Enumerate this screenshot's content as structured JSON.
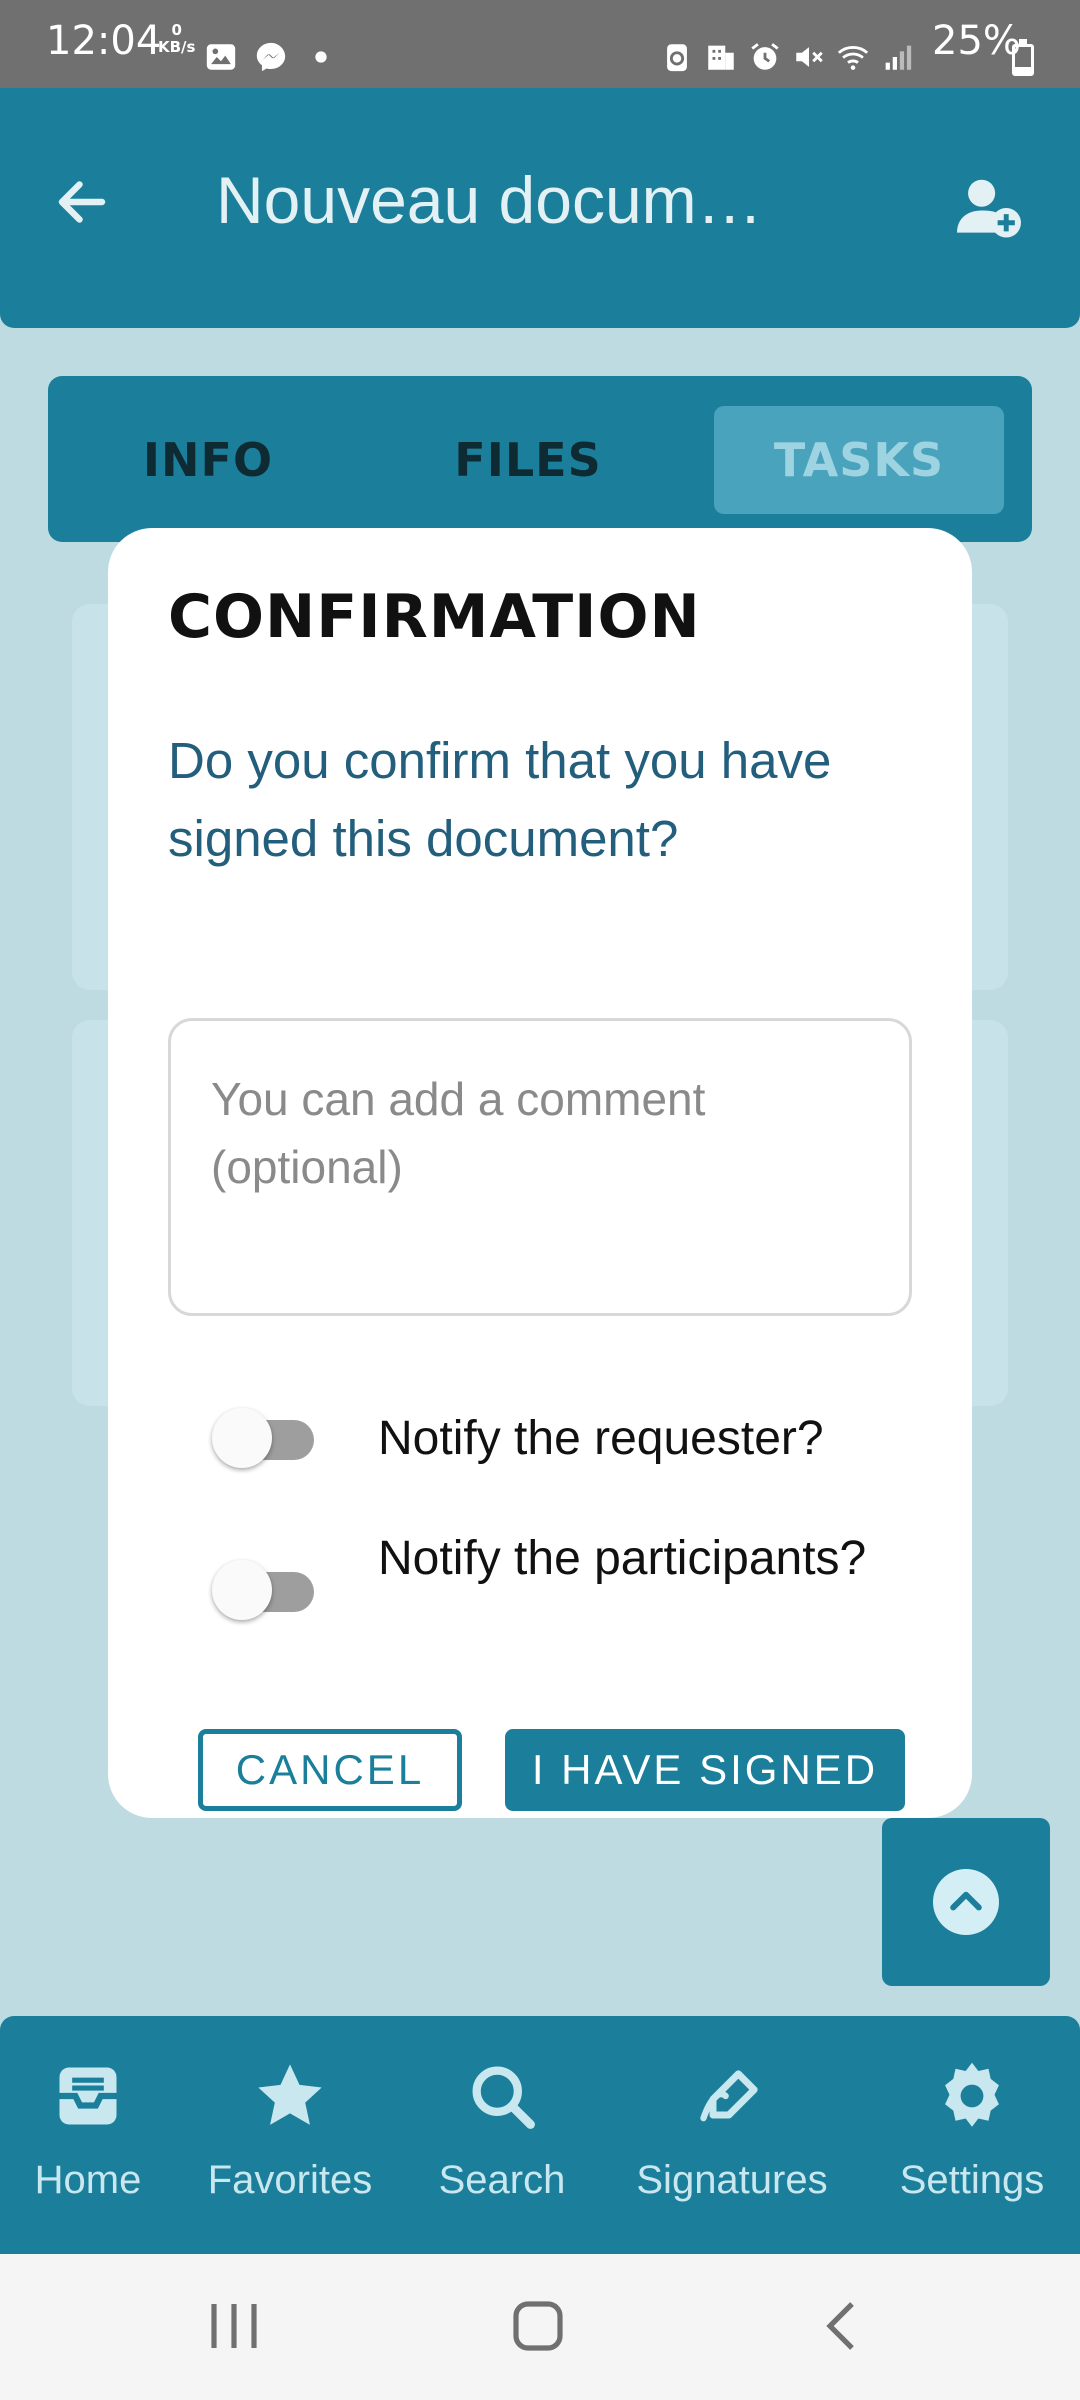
{
  "status_bar": {
    "time": "12:04",
    "data_rate_value": "0",
    "data_rate_unit": "KB/s",
    "battery_text": "25%",
    "battery_level": 0.25
  },
  "app_bar": {
    "title": "Nouveau docum…"
  },
  "tabs": [
    {
      "label": "INFO",
      "active": false
    },
    {
      "label": "FILES",
      "active": false
    },
    {
      "label": "TASKS",
      "active": true
    }
  ],
  "dialog": {
    "title": "CONFIRMATION",
    "question": "Do you confirm that you have signed this document?",
    "comment_placeholder": "You can add a comment (optional)",
    "comment_value": "",
    "toggles": [
      {
        "label": "Notify the requester?",
        "on": false
      },
      {
        "label": "Notify the participants?",
        "on": false
      }
    ],
    "cancel_label": "CANCEL",
    "confirm_label": "I HAVE SIGNED"
  },
  "bottom_nav": [
    {
      "label": "Home",
      "icon": "inbox-icon"
    },
    {
      "label": "Favorites",
      "icon": "star-icon"
    },
    {
      "label": "Search",
      "icon": "search-icon"
    },
    {
      "label": "Signatures",
      "icon": "signature-pen-icon"
    },
    {
      "label": "Settings",
      "icon": "gear-icon"
    }
  ],
  "colors": {
    "primary": "#1b7f9b",
    "accent_text": "#235f7d",
    "background": "#bfdbe2"
  }
}
